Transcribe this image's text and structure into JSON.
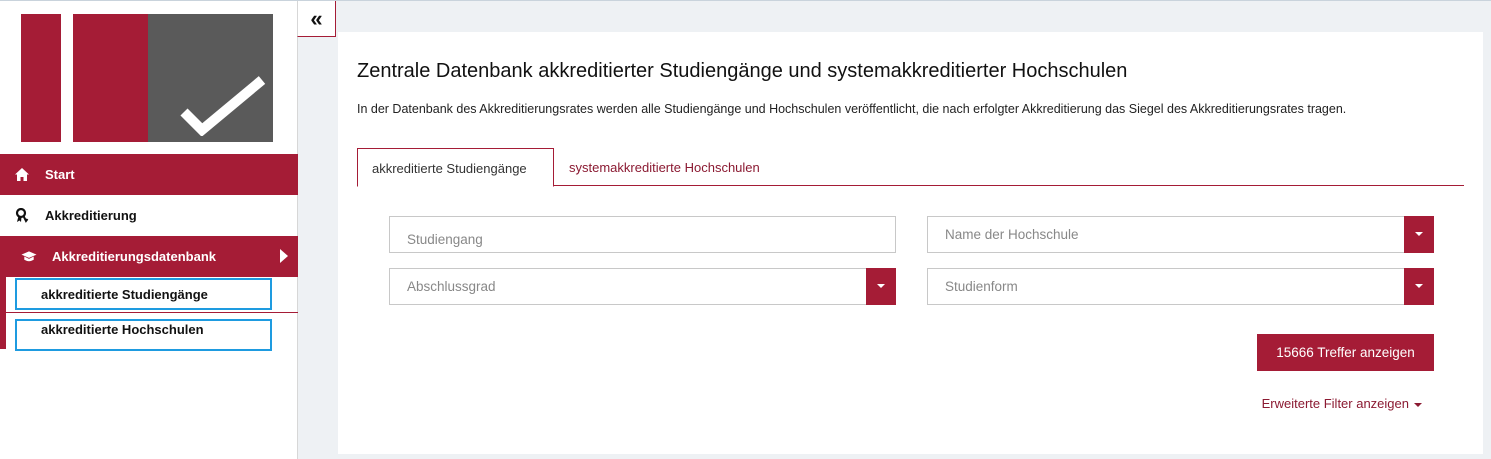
{
  "sidebar": {
    "nav": [
      {
        "label": "Start",
        "icon": "home-icon",
        "active": true
      },
      {
        "label": "Akkreditierung",
        "icon": "award-icon",
        "active": false
      },
      {
        "label": "Akkreditierungsdatenbank",
        "icon": "graduation-cap-icon",
        "active": true
      }
    ],
    "subnav": [
      {
        "label": "akkreditierte Studiengänge"
      },
      {
        "label": "akkreditierte Hochschulen"
      }
    ],
    "collapse_glyph": "«"
  },
  "main": {
    "title": "Zentrale Datenbank akkreditierter Studiengänge und systemakkreditierter Hochschulen",
    "intro": "In der Datenbank des Akkreditierungsrates werden alle Studiengänge und Hochschulen veröffentlicht, die nach erfolgter Akkreditierung das Siegel des Akkreditierungsrates tragen.",
    "tabs": [
      {
        "label": "akkreditierte Studiengänge",
        "active": true
      },
      {
        "label": "systemakkreditierte Hochschulen",
        "active": false
      }
    ],
    "filters": {
      "studiengang_placeholder": "Studiengang",
      "hochschule_placeholder": "Name der Hochschule",
      "abschlussgrad_placeholder": "Abschlussgrad",
      "studienform_placeholder": "Studienform"
    },
    "submit_label": "15666 Treffer anzeigen",
    "more_filters_label": "Erweiterte Filter anzeigen"
  },
  "colors": {
    "brand": "#a51c36",
    "logo_gray": "#5a5a5a",
    "focus_outline": "#1e9be0"
  }
}
